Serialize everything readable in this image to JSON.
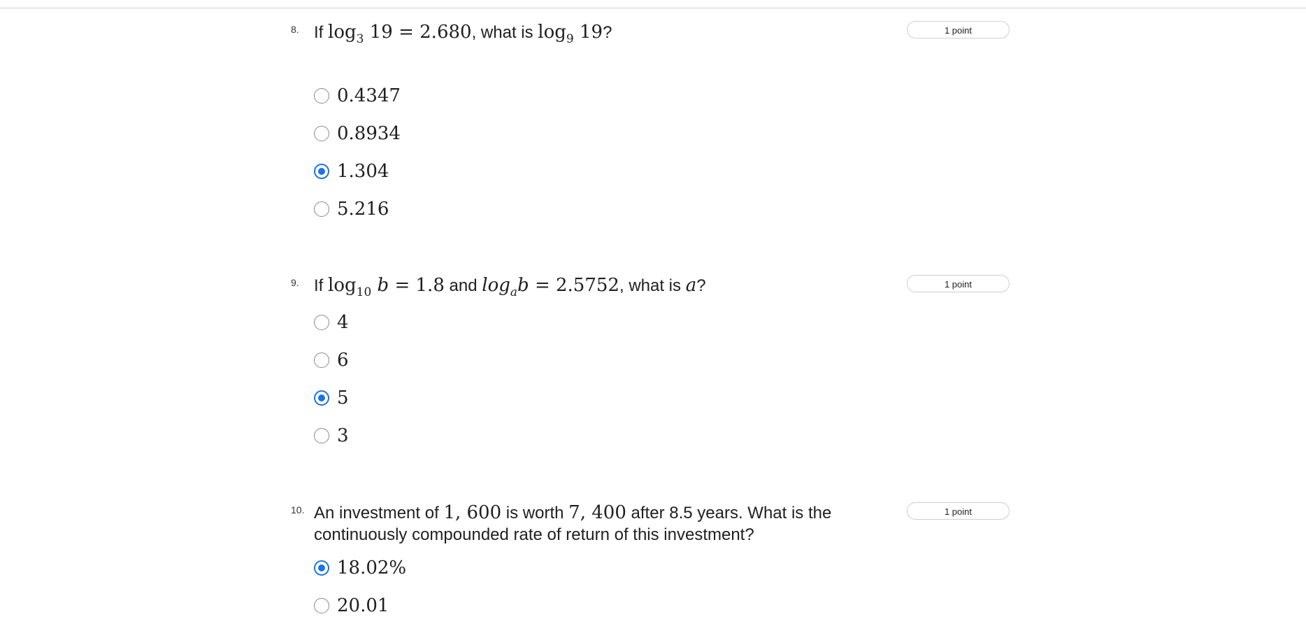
{
  "questions": [
    {
      "number": "8.",
      "text_parts": {
        "prefix": "If ",
        "log_a": "log",
        "sub_a": "3",
        "eq_a": " 19 = 2.680",
        "middle": ", what is ",
        "log_b": "log",
        "sub_b": "9",
        "eq_b": " 19",
        "suffix": "?"
      },
      "points": "1 point",
      "options": [
        {
          "label": "0.4347",
          "selected": false
        },
        {
          "label": "0.8934",
          "selected": false
        },
        {
          "label": "1.304",
          "selected": true
        },
        {
          "label": "5.216",
          "selected": false
        }
      ]
    },
    {
      "number": "9.",
      "text_parts": {
        "prefix": "If ",
        "log_a": "log",
        "sub_a": "10",
        "eq_a_var": " b",
        "eq_a": " = 1.8",
        "middle": " and ",
        "log_b": "log",
        "sub_b": "a",
        "eq_b_var": "b",
        "eq_b": " = 2.5752",
        "middle2": ", what is ",
        "var_a": "a",
        "suffix": "?"
      },
      "points": "1 point",
      "options": [
        {
          "label": "4",
          "selected": false
        },
        {
          "label": "6",
          "selected": false
        },
        {
          "label": "5",
          "selected": true
        },
        {
          "label": "3",
          "selected": false
        }
      ]
    },
    {
      "number": "10.",
      "text_parts": {
        "prefix": "An investment of ",
        "amount_a": "1, 600",
        "middle": " is worth ",
        "amount_b": "7, 400",
        "suffix": " after 8.5 years. What is the continuously compounded rate of return of this investment?"
      },
      "points": "1 point",
      "options": [
        {
          "label": "18.02%",
          "selected": true
        },
        {
          "label": "20.01",
          "selected": false
        }
      ]
    }
  ]
}
